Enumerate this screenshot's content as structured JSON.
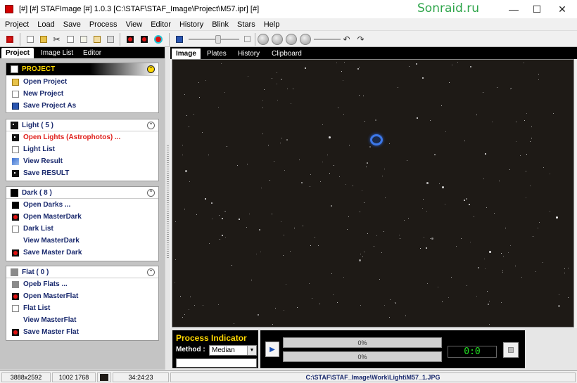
{
  "window": {
    "title": "[#] [#] STAFImage [#]  1.0.3  [C:\\STAF\\STAF_Image\\Project\\M57.ipr] [#]",
    "watermark": "Sonraid.ru",
    "controls": {
      "minimize": "—",
      "maximize": "☐",
      "close": "✕"
    }
  },
  "menu": [
    "Project",
    "Load",
    "Save",
    "Process",
    "View",
    "Editor",
    "History",
    "Blink",
    "Stars",
    "Help"
  ],
  "left_tabs": [
    "Project",
    "Image List",
    "Editor"
  ],
  "panels": {
    "project": {
      "title": "PROJECT",
      "items": [
        "Open Project",
        "New Project",
        "Save Project As"
      ]
    },
    "light": {
      "title": "Light  ( 5 )",
      "items": [
        "Open Lights (Astrophotos) ...",
        "Light List",
        "View Result",
        "Save RESULT"
      ]
    },
    "dark": {
      "title": "Dark  ( 8 )",
      "items": [
        "Open Darks ...",
        "Open MasterDark",
        "Dark List",
        "View MasterDark",
        "Save Master Dark"
      ]
    },
    "flat": {
      "title": "Flat  ( 0 )",
      "items": [
        "Opeb Flats ...",
        "Open MasterFlat",
        "Flat List",
        "View MasterFlat",
        "Save Master Flat"
      ]
    }
  },
  "right_tabs": [
    "Image",
    "Plates",
    "History",
    "Clipboard"
  ],
  "process": {
    "title": "Process Indicator",
    "method_label": "Method :",
    "method_value": "Median",
    "progress1": "0%",
    "progress2": "0%",
    "timer": "0:0"
  },
  "status": {
    "image_size": "3888x2592",
    "cursor": "1002 1768",
    "time": "34:24:23",
    "path": "C:\\STAF\\STAF_Image\\Work\\Light\\M57_1.JPG"
  },
  "colors": {
    "accent_yellow": "#ffd800",
    "link_blue": "#1a2a6e",
    "link_red": "#e0201c",
    "timer_green": "#22e022",
    "nebula_blue": "#3d78e8"
  }
}
